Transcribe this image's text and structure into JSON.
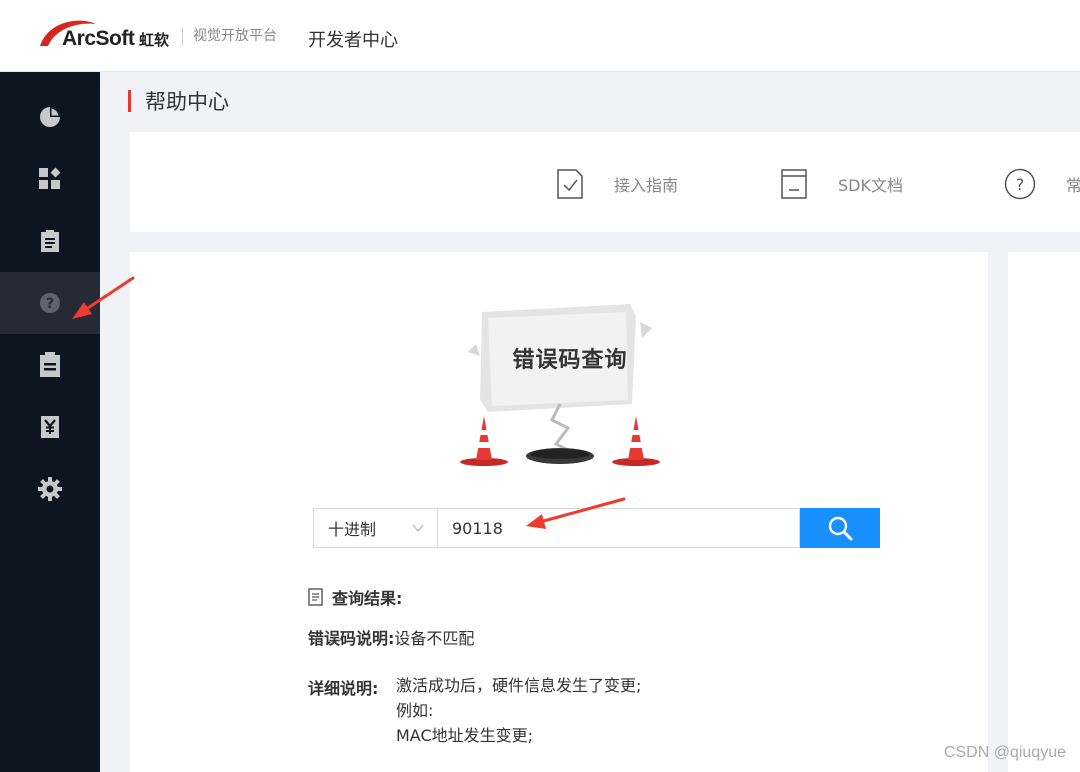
{
  "header": {
    "brand": "ArcSoft",
    "brand_cn": "虹软",
    "tagline": "视觉开放平台",
    "nav_title": "开发者中心"
  },
  "sidebar": {
    "items": [
      {
        "icon": "pie-chart-icon",
        "active": false
      },
      {
        "icon": "dashboard-grid-icon",
        "active": false
      },
      {
        "icon": "clipboard-list-icon",
        "active": false
      },
      {
        "icon": "question-circle-icon",
        "active": true
      },
      {
        "icon": "clipboard-icon",
        "active": false
      },
      {
        "icon": "yen-icon",
        "active": false
      },
      {
        "icon": "gear-icon",
        "active": false
      }
    ]
  },
  "page": {
    "title": "帮助中心"
  },
  "quick_links": [
    {
      "label": "接入指南",
      "icon": "guide-check-icon"
    },
    {
      "label": "SDK文档",
      "icon": "document-icon"
    },
    {
      "label": "常",
      "icon": "question-circle-icon"
    }
  ],
  "illustration": {
    "title": "错误码查询"
  },
  "search": {
    "base_selected": "十进制",
    "code_value": "90118"
  },
  "result": {
    "heading": "查询结果:",
    "error_desc_key": "错误码说明:",
    "error_desc_val": "设备不匹配",
    "detail_key": "详细说明:",
    "detail_lines": [
      "激活成功后，硬件信息发生了变更;",
      "例如:",
      "MAC地址发生变更;"
    ]
  },
  "colors": {
    "accent_red": "#e53935",
    "primary_blue": "#1890ff",
    "sidebar_bg": "#0d1620",
    "annotation_arrow": "#f03a2e"
  },
  "watermark": "CSDN @qiuqyue"
}
